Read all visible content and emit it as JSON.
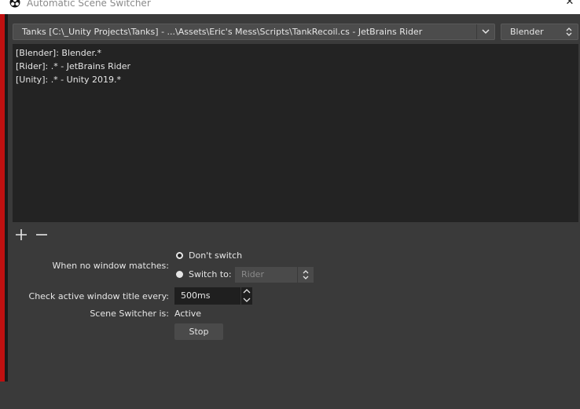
{
  "window": {
    "title": "Automatic Scene Switcher",
    "close_glyph": "✕"
  },
  "window_select": {
    "value": "Tanks [C:\\_Unity Projects\\Tanks] - ...\\Assets\\Eric's Mess\\Scripts\\TankRecoil.cs - JetBrains Rider"
  },
  "scene_select": {
    "value": "Blender"
  },
  "rules": [
    "[Blender]: Blender.*",
    "[Rider]: .* - JetBrains Rider",
    "[Unity]: .* - Unity 2019.*"
  ],
  "no_match": {
    "label": "When no window matches:",
    "dont_switch": "Don't switch",
    "switch_to": "Switch to:",
    "switch_scene": "Rider"
  },
  "interval": {
    "label": "Check active window title every:",
    "value": "500ms"
  },
  "status": {
    "label": "Scene Switcher is:",
    "value": "Active"
  },
  "stop_button": "Stop",
  "colors": {
    "background": "#3a3a3a",
    "list_background": "#232323",
    "accent_red": "#c01010"
  }
}
